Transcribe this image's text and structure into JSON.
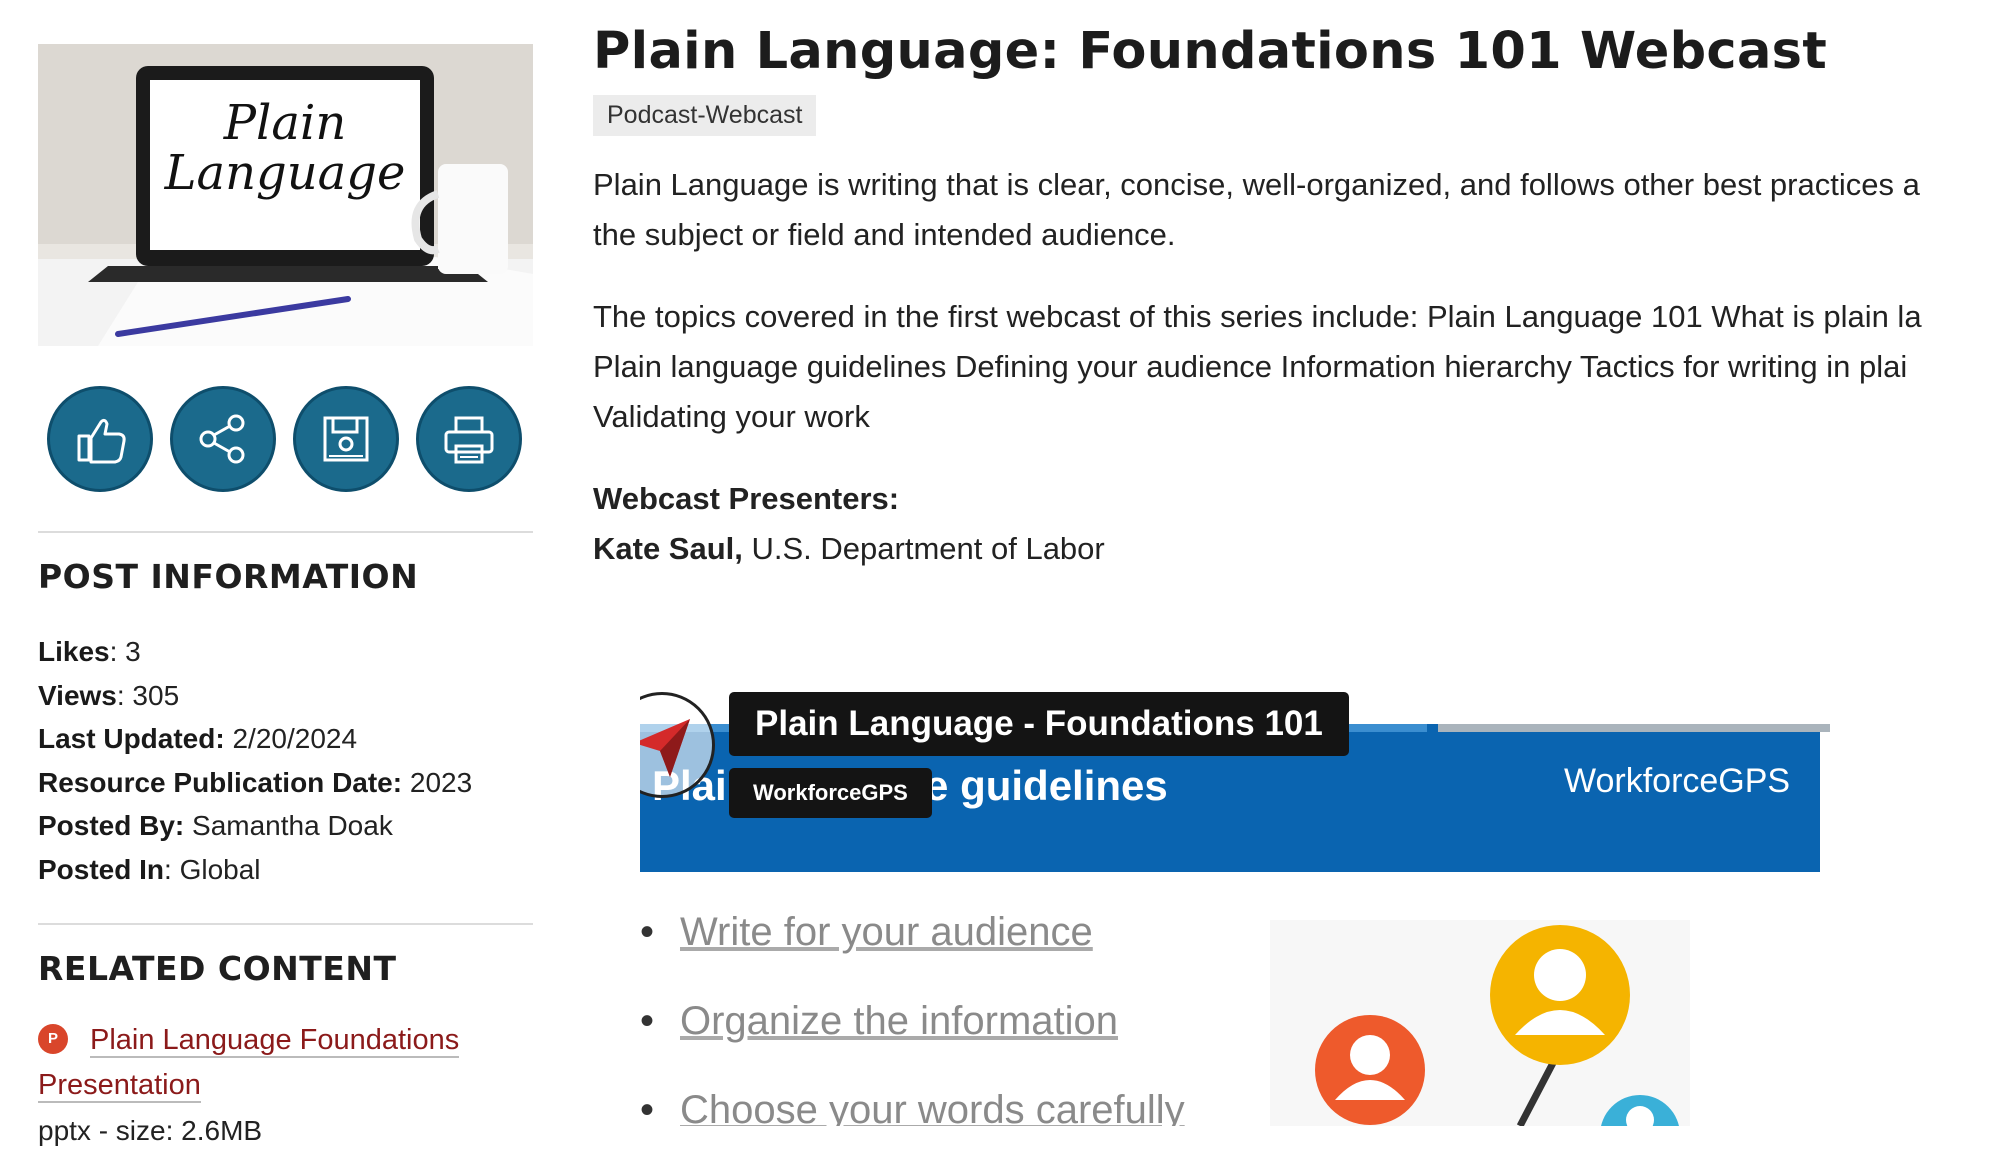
{
  "page": {
    "title": "Plain Language: Foundations 101 Webcast",
    "tag": "Podcast-Webcast",
    "description_1": "Plain Language is writing that is clear, concise, well-organized, and follows other best practices a",
    "description_1b": "the subject or field and intended audience.",
    "description_2a": "The topics covered in the first webcast of this series include: Plain Language 101 What is plain la",
    "description_2b": "Plain language guidelines Defining your audience Information hierarchy Tactics for writing in plai",
    "description_2c": "Validating your work",
    "presenters_label": "Webcast Presenters:",
    "presenter_name": "Kate Saul,",
    "presenter_org": " U.S. Department of Labor"
  },
  "thumbnail": {
    "text_line1": "Plain",
    "text_line2": "Language"
  },
  "social": {
    "like_icon": "thumbs-up-icon",
    "share_icon": "share-icon",
    "save_icon": "floppy-disk-icon",
    "print_icon": "printer-icon"
  },
  "post_info": {
    "heading": "POST INFORMATION",
    "likes_label": "Likes",
    "likes_value": ": 3",
    "views_label": "Views",
    "views_value": ": 305",
    "updated_label": "Last Updated:",
    "updated_value": " 2/20/2024",
    "pubdate_label": "Resource Publication Date:",
    "pubdate_value": " 2023",
    "postedby_label": "Posted By:",
    "postedby_value": " Samantha Doak",
    "postedin_label": "Posted In",
    "postedin_value": ": Global"
  },
  "related": {
    "heading": "RELATED CONTENT",
    "item_title_1": "Plain Language Foundations",
    "item_title_2": "Presentation",
    "item_meta": "pptx - size: 2.6MB",
    "item_icon": "powerpoint-icon"
  },
  "video": {
    "overlay_title": "Plain Language - Foundations 101",
    "overlay_channel": "WorkforceGPS",
    "slide_heading": "Plain language guidelines",
    "slide_logo": "WorkforceGPS",
    "bullets": [
      "Write for your audience",
      "Organize the information",
      "Choose your words carefully"
    ]
  },
  "colors": {
    "accent_teal": "#1b6a8c",
    "link_red": "#8b1a1a",
    "slide_blue": "#0a64b0"
  }
}
